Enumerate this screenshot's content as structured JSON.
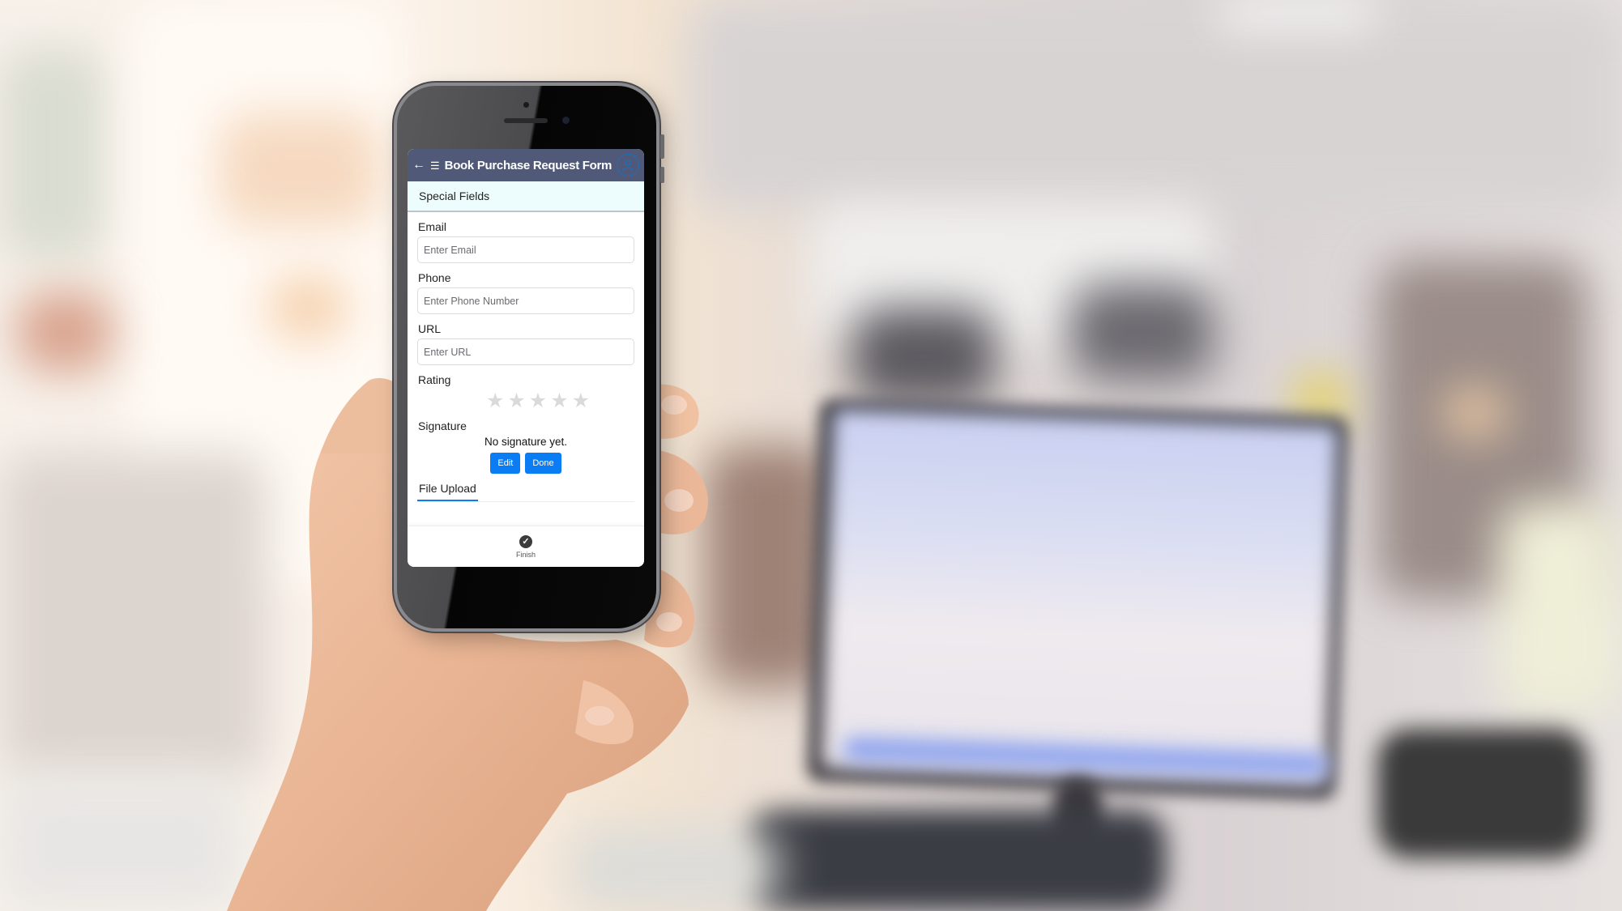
{
  "app": {
    "title": "Book Purchase Request Form",
    "icons": {
      "back": "arrow-left-icon",
      "menu": "hamburger-menu-icon",
      "profile": "user-avatar-icon"
    },
    "header_color": "#505a78"
  },
  "section": {
    "title": "Special Fields"
  },
  "fields": {
    "email": {
      "label": "Email",
      "placeholder": "Enter Email",
      "value": ""
    },
    "phone": {
      "label": "Phone",
      "placeholder": "Enter Phone Number",
      "value": ""
    },
    "url": {
      "label": "URL",
      "placeholder": "Enter URL",
      "value": ""
    }
  },
  "rating": {
    "label": "Rating",
    "value": 0,
    "max": 5,
    "glyph": "★"
  },
  "signature": {
    "label": "Signature",
    "status": "No signature yet.",
    "edit_label": "Edit",
    "done_label": "Done",
    "button_color": "#0a7df5"
  },
  "tabs": [
    {
      "label": "File Upload",
      "active": true
    }
  ],
  "footer": {
    "finish_label": "Finish",
    "finish_icon": "check-circle-icon"
  },
  "glyphs": {
    "back": "←",
    "menu": "☰",
    "check": "✓"
  }
}
